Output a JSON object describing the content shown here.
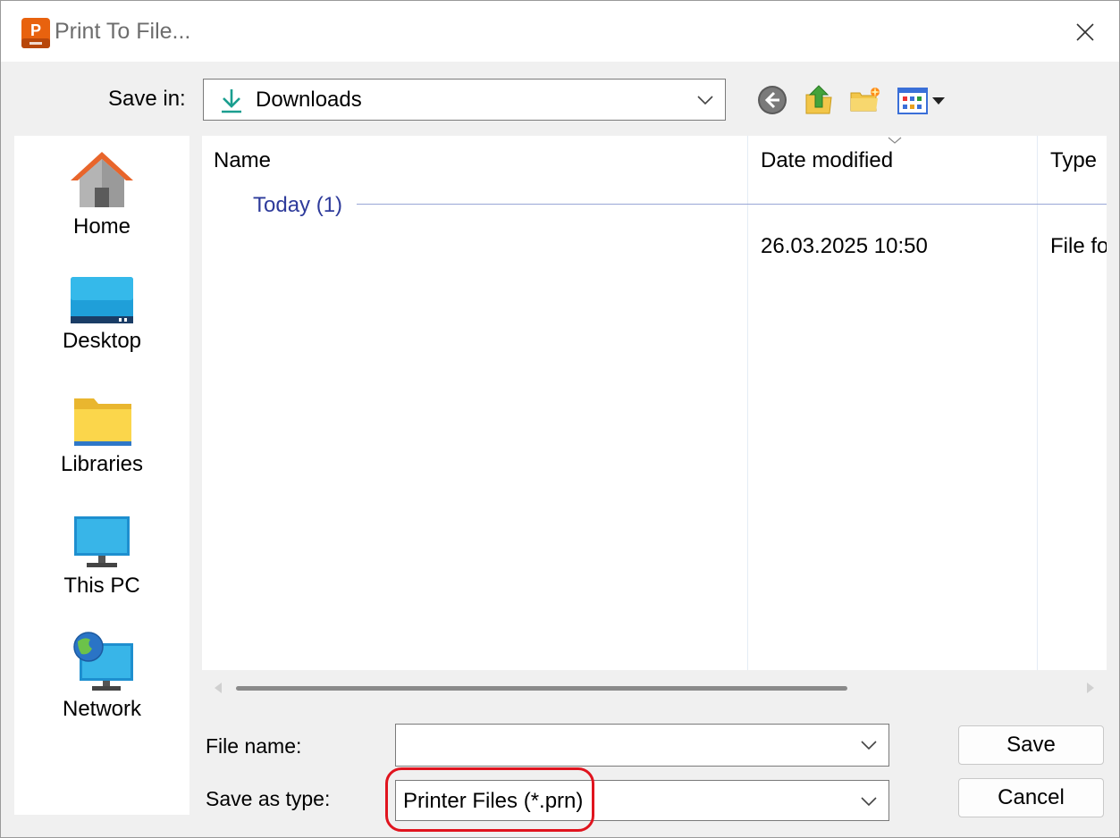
{
  "window": {
    "title": "Print To File..."
  },
  "save_in": {
    "label": "Save in:",
    "value": "Downloads"
  },
  "places": [
    {
      "label": "Home",
      "icon": "home-icon"
    },
    {
      "label": "Desktop",
      "icon": "desktop-icon"
    },
    {
      "label": "Libraries",
      "icon": "libraries-icon"
    },
    {
      "label": "This PC",
      "icon": "this-pc-icon"
    },
    {
      "label": "Network",
      "icon": "network-icon"
    }
  ],
  "file_list": {
    "columns": [
      "Name",
      "Date modified",
      "Type"
    ],
    "group": "Today (1)",
    "rows": [
      {
        "name": "",
        "date": "26.03.2025 10:50",
        "type": "File fo"
      }
    ]
  },
  "file_name": {
    "label": "File name:",
    "value": ""
  },
  "save_as_type": {
    "label": "Save as type:",
    "value": "Printer Files (*.prn)"
  },
  "buttons": {
    "save": "Save",
    "cancel": "Cancel"
  },
  "colors": {
    "accent": "#0078d4",
    "group_text": "#2e3b9b",
    "highlight": "#e0141e"
  }
}
